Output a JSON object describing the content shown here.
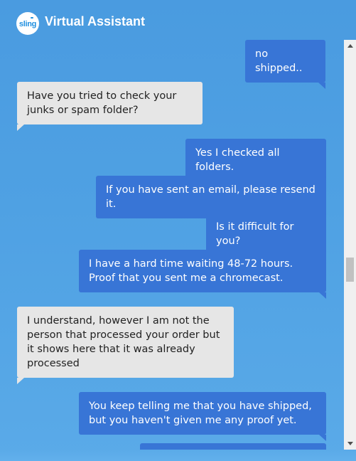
{
  "header": {
    "logo_text": "sling",
    "title": "Virtual Assistant"
  },
  "colors": {
    "background": "#4f9fe0",
    "user_bubble": "#3875d6",
    "agent_bubble": "#e6e6e6"
  },
  "messages": [
    {
      "sender": "user",
      "text": "no shipped.."
    },
    {
      "sender": "agent",
      "text": "Have you tried to check your junks or spam folder?"
    },
    {
      "sender": "user",
      "text": "Yes I checked all folders."
    },
    {
      "sender": "user",
      "text": "If you have sent an email, please resend it."
    },
    {
      "sender": "user",
      "text": "Is it difficult for you?"
    },
    {
      "sender": "user",
      "text": "I have a hard time waiting 48-72 hours. Proof that you sent me a chromecast."
    },
    {
      "sender": "agent",
      "text": "I understand, however I am not the person that processed your order but it shows here that it was already processed"
    },
    {
      "sender": "user",
      "text": "You keep telling me that you have shipped, but you haven't given me any proof yet."
    },
    {
      "sender": "user",
      "text": ""
    }
  ]
}
